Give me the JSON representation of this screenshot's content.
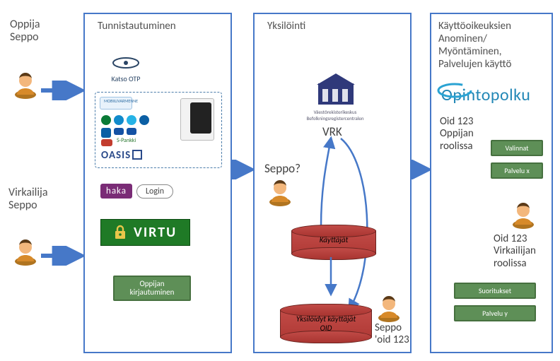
{
  "roles": {
    "learner": "Oppija\nSeppo",
    "official": "Virkailija\nSeppo"
  },
  "panels": {
    "auth": {
      "title": "Tunnistautuminen",
      "katso_label": "Katso OTP",
      "tupas_box": {
        "title": "MOBIILIVARMENNE",
        "oasis": "OASIS",
        "spankki": "S-Pankki"
      },
      "haka": {
        "badge": "haka",
        "login": "Login"
      },
      "virtu": "VIRTU",
      "learner_login": "Oppijan\nkirjautuminen"
    },
    "id": {
      "title": "Yksilöinti",
      "vrk_sub": "Väestörekisterikeskus\nBefolkningsregistercentralen",
      "vrk_label": "VRK",
      "seppo_q": "Seppo?",
      "db_users": "Käyttäjät",
      "db_identified": "Yksilöidyt käyttäjät\nOID",
      "seppo_oid": "Seppo\n'oid 123"
    },
    "perm": {
      "title": "Käyttöoikeuksien\nAnominen/\nMyöntäminen,\nPalvelujen käyttö",
      "brand": "Opintopolku",
      "learner_role": "Oid 123\nOppijan\nroolissa",
      "official_role": "Oid 123\nVirkailijan\nroolissa",
      "btn_valinnat": "Valinnat",
      "btn_palvelu_x": "Palvelu x",
      "btn_suoritukset": "Suoritukset",
      "btn_palvelu_y": "Palvelu  y"
    }
  },
  "icons": {
    "person": "person-icon",
    "lock": "lock-icon",
    "arrow": "arrow-icon"
  }
}
